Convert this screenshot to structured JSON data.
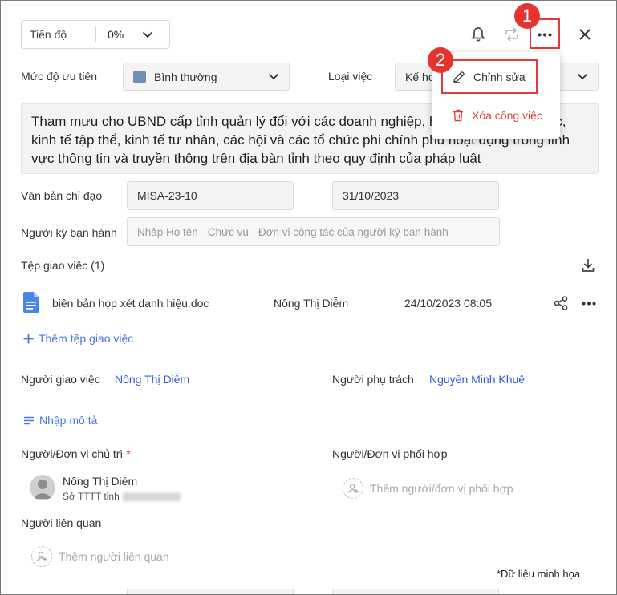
{
  "progress": {
    "label": "Tiến độ",
    "value": "0%"
  },
  "priority": {
    "label": "Mức độ ưu tiên",
    "value": "Bình thường",
    "swatch_color": "#6e8fb0"
  },
  "task_type": {
    "label": "Loại việc",
    "value_partial": "Kế ho"
  },
  "menu": {
    "edit_label": "Chỉnh sửa",
    "delete_label": "Xóa công việc",
    "delete_color": "#e0413c"
  },
  "annotations": {
    "step1": "1",
    "step2": "2",
    "highlight_color": "#e03a3a"
  },
  "description": "Tham mưu cho UBND cấp tỉnh quản lý đối với các doanh nghiệp, hợp tác xã, tổ hợp tác, kinh tế tập thể, kinh tế tư nhân, các hội và các tổ chức phi chính phủ hoạt động trong lĩnh vực thông tin và truyền thông trên địa bàn tỉnh theo quy định của pháp luật",
  "directive_doc": {
    "label": "Văn bản chỉ đạo",
    "number": "MISA-23-10",
    "date": "31/10/2023"
  },
  "signer": {
    "label": "Người ký ban hành",
    "placeholder": "Nhập Họ tên - Chức vụ - Đơn vị công tác của người ký ban hành"
  },
  "attachments": {
    "label": "Tệp giao việc (1)",
    "files": [
      {
        "name": "biên bản họp xét danh hiệu.doc",
        "owner": "Nông Thị Diễm",
        "datetime": "24/10/2023 08:05"
      }
    ],
    "add_label": "Thêm tệp giao việc"
  },
  "assigner": {
    "label": "Người giao việc",
    "name": "Nông Thị Diễm"
  },
  "responsible": {
    "label": "Người phụ trách",
    "name": "Nguyễn Minh Khuê"
  },
  "describe_link": "Nhập mô tả",
  "lead_unit": {
    "label": "Người/Đơn vị chủ trì",
    "required_mark": "*",
    "person_name": "Nông Thị Diễm",
    "person_org": "Sở TTTT tỉnh"
  },
  "coordinator": {
    "label": "Người/Đơn vị phối hợp",
    "add_label": "Thêm người/đơn vị phối hợp"
  },
  "related": {
    "label": "Người liên quan",
    "add_label": "Thêm người liên quan"
  },
  "footnote": "*Dữ liệu minh họa"
}
